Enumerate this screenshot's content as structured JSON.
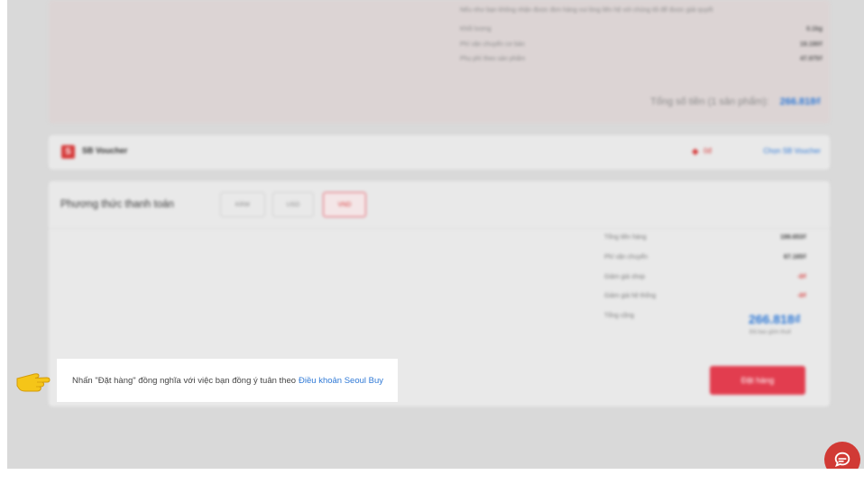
{
  "shipping": {
    "note": "Nếu như bạn không nhận được đơn hàng vui lòng liên hệ với chúng tôi để được giải quyết",
    "rows": [
      {
        "label": "Khối lượng",
        "value": "0.1kg"
      },
      {
        "label": "Phí vận chuyển cơ bản",
        "value": "19.190₫"
      },
      {
        "label": "Phụ phí theo sản phẩm",
        "value": "47.975₫"
      }
    ],
    "total_label": "Tổng số tiền (1 sản phẩm):",
    "total_value": "266.818₫"
  },
  "voucher": {
    "icon_text": "S",
    "label": "SB Voucher",
    "amount": "0đ",
    "choose_label": "Chọn SB Voucher"
  },
  "payment": {
    "title": "Phương thức thanh toán",
    "currencies": [
      "KRW",
      "USD",
      "VND"
    ],
    "selected": "VND",
    "summary": [
      {
        "label": "Tổng tiền hàng",
        "value": "199.653₫"
      },
      {
        "label": "Phí vận chuyển",
        "value": "67.165₫"
      },
      {
        "label": "Giảm giá shop",
        "value": "-0₫"
      },
      {
        "label": "Giảm giá hệ thống",
        "value": "-0₫"
      },
      {
        "label": "Tổng cộng",
        "value": ""
      }
    ],
    "grand_total": "266.818₫",
    "tax_note": "Đã bao gồm thuế",
    "order_button": "Đặt hàng"
  },
  "terms": {
    "text": "Nhấn \"Đặt hàng\" đồng nghĩa với việc bạn đồng ý tuân theo",
    "link": "Điều khoản Seoul Buy"
  },
  "colors": {
    "accent_red": "#e23d4f",
    "link_blue": "#2f79d6",
    "pointer_hand": "#f5c518"
  },
  "icons": {
    "pointer": "pointing-hand-icon",
    "chat": "chat-bubble-icon",
    "tag": "price-tag-icon"
  }
}
